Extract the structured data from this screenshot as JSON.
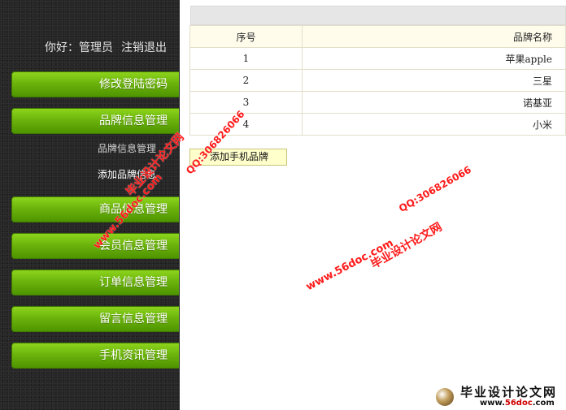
{
  "sidebar": {
    "greeting": "你好：",
    "user": "管理员",
    "logout": "注销退出",
    "menu": [
      {
        "label": "修改登陆密码"
      },
      {
        "label": "品牌信息管理"
      },
      {
        "label": "商品信息管理"
      },
      {
        "label": "会员信息管理"
      },
      {
        "label": "订单信息管理"
      },
      {
        "label": "留言信息管理"
      },
      {
        "label": "手机资讯管理"
      }
    ],
    "submenu": [
      {
        "label": "品牌信息管理"
      },
      {
        "label": "添加品牌信息"
      }
    ]
  },
  "table": {
    "headers": {
      "no": "序号",
      "name": "品牌名称"
    },
    "rows": [
      {
        "no": "1",
        "name": "苹果apple"
      },
      {
        "no": "2",
        "name": "三星"
      },
      {
        "no": "3",
        "name": "诺基亚"
      },
      {
        "no": "4",
        "name": "小米"
      }
    ]
  },
  "add_button": "添加手机品牌",
  "watermark": {
    "site_cn": "毕业设计论文网",
    "site_url": "www.56doc.com",
    "qq": "QQ:306826066",
    "logo_title": "毕业设计论文网",
    "logo_url_prefix": "www.",
    "logo_url_main": "56doc",
    "logo_url_suffix": ".com"
  },
  "colors": {
    "menu_green": "#6cb40c",
    "sidebar_bg": "#262626",
    "watermark_red": "#ff1a1a"
  }
}
